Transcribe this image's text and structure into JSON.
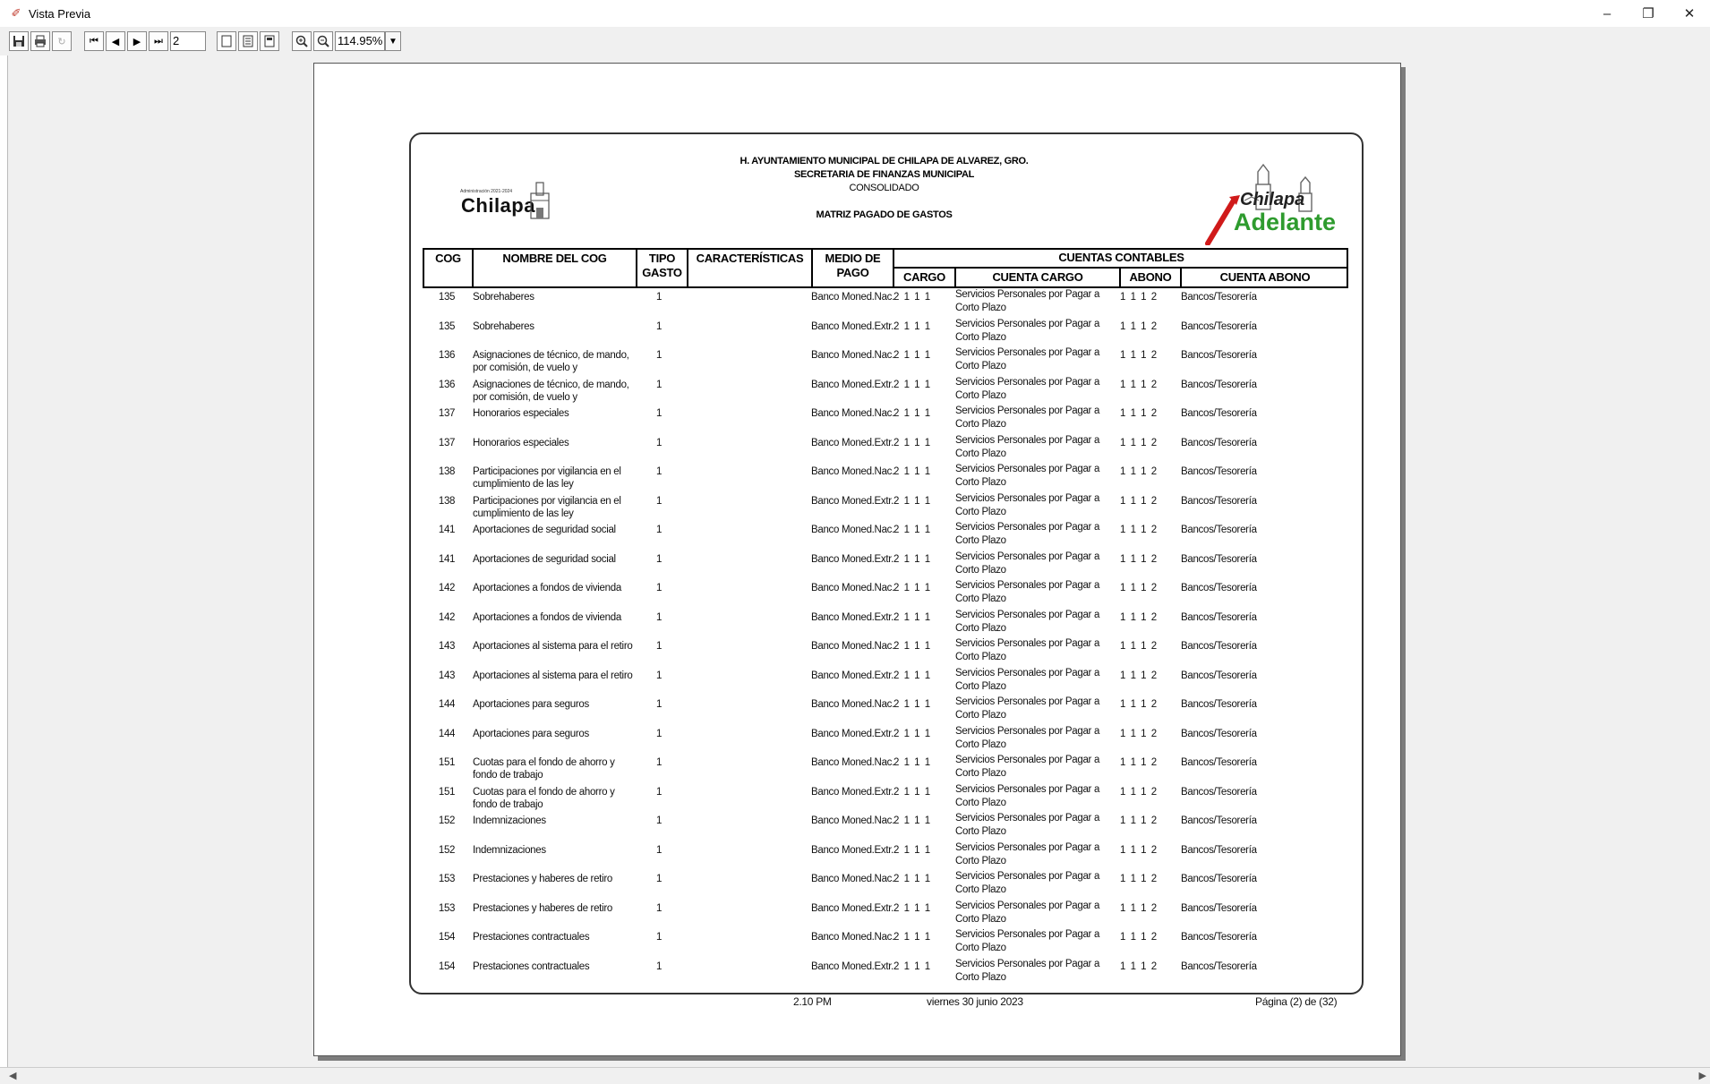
{
  "window": {
    "title": "Vista Previa",
    "minimize": "–",
    "restore": "❐",
    "close": "✕"
  },
  "toolbar": {
    "page_value": "2",
    "zoom_value": "114.95%"
  },
  "report": {
    "line1": "H. AYUNTAMIENTO MUNICIPAL DE CHILAPA DE ALVAREZ, GRO.",
    "line2": "SECRETARIA DE FINANZAS MUNICIPAL",
    "line3": "CONSOLIDADO",
    "line4": "MATRIZ PAGADO DE GASTOS",
    "logo_left_small": "Administración 2021-2024",
    "logo_left_word": "Chilapa",
    "logo_right_top": "Chilapa",
    "logo_right_bottom": "Adelante"
  },
  "table": {
    "headers": {
      "cog": "COG",
      "nombre": "NOMBRE DEL COG",
      "tipo": "TIPO GASTO",
      "caracteristicas": "CARACTERÍSTICAS",
      "medio": "MEDIO DE PAGO",
      "cuentas": "CUENTAS CONTABLES",
      "cargo": "CARGO",
      "cuenta_cargo": "CUENTA CARGO",
      "abono": "ABONO",
      "cuenta_abono": "CUENTA ABONO"
    },
    "rows": [
      {
        "cog": "135",
        "nombre": "Sobrehaberes",
        "tipo": "1",
        "medio": "Banco Moned.Nac.",
        "cargo": "2 1 1 1",
        "cuenta_cargo": "Servicios Personales por Pagar a Corto Plazo",
        "abono": "1 1 1 2",
        "cuenta_abono": "Bancos/Tesorería"
      },
      {
        "cog": "135",
        "nombre": "Sobrehaberes",
        "tipo": "1",
        "medio": "Banco Moned.Extr.",
        "cargo": "2 1 1 1",
        "cuenta_cargo": "Servicios Personales por Pagar a Corto Plazo",
        "abono": "1 1 1 2",
        "cuenta_abono": "Bancos/Tesorería"
      },
      {
        "cog": "136",
        "nombre": "Asignaciones de técnico, de mando, por comisión, de vuelo y",
        "tipo": "1",
        "medio": "Banco Moned.Nac.",
        "cargo": "2 1 1 1",
        "cuenta_cargo": "Servicios Personales por Pagar a Corto Plazo",
        "abono": "1 1 1 2",
        "cuenta_abono": "Bancos/Tesorería"
      },
      {
        "cog": "136",
        "nombre": "Asignaciones de técnico, de mando, por comisión, de vuelo y",
        "tipo": "1",
        "medio": "Banco Moned.Extr.",
        "cargo": "2 1 1 1",
        "cuenta_cargo": "Servicios Personales por Pagar a Corto Plazo",
        "abono": "1 1 1 2",
        "cuenta_abono": "Bancos/Tesorería"
      },
      {
        "cog": "137",
        "nombre": "Honorarios especiales",
        "tipo": "1",
        "medio": "Banco Moned.Nac.",
        "cargo": "2 1 1 1",
        "cuenta_cargo": "Servicios Personales por Pagar a Corto Plazo",
        "abono": "1 1 1 2",
        "cuenta_abono": "Bancos/Tesorería"
      },
      {
        "cog": "137",
        "nombre": "Honorarios especiales",
        "tipo": "1",
        "medio": "Banco Moned.Extr.",
        "cargo": "2 1 1 1",
        "cuenta_cargo": "Servicios Personales por Pagar a Corto Plazo",
        "abono": "1 1 1 2",
        "cuenta_abono": "Bancos/Tesorería"
      },
      {
        "cog": "138",
        "nombre": "Participaciones por vigilancia en el cumplimiento de las ley",
        "tipo": "1",
        "medio": "Banco Moned.Nac.",
        "cargo": "2 1 1 1",
        "cuenta_cargo": "Servicios Personales por Pagar a Corto Plazo",
        "abono": "1 1 1 2",
        "cuenta_abono": "Bancos/Tesorería"
      },
      {
        "cog": "138",
        "nombre": "Participaciones por vigilancia en el cumplimiento de las ley",
        "tipo": "1",
        "medio": "Banco Moned.Extr.",
        "cargo": "2 1 1 1",
        "cuenta_cargo": "Servicios Personales por Pagar a Corto Plazo",
        "abono": "1 1 1 2",
        "cuenta_abono": "Bancos/Tesorería"
      },
      {
        "cog": "141",
        "nombre": "Aportaciones de seguridad social",
        "tipo": "1",
        "medio": "Banco Moned.Nac.",
        "cargo": "2 1 1 1",
        "cuenta_cargo": "Servicios Personales por Pagar a Corto Plazo",
        "abono": "1 1 1 2",
        "cuenta_abono": "Bancos/Tesorería"
      },
      {
        "cog": "141",
        "nombre": "Aportaciones de seguridad social",
        "tipo": "1",
        "medio": "Banco Moned.Extr.",
        "cargo": "2 1 1 1",
        "cuenta_cargo": "Servicios Personales por Pagar a Corto Plazo",
        "abono": "1 1 1 2",
        "cuenta_abono": "Bancos/Tesorería"
      },
      {
        "cog": "142",
        "nombre": "Aportaciones a fondos de vivienda",
        "tipo": "1",
        "medio": "Banco Moned.Nac.",
        "cargo": "2 1 1 1",
        "cuenta_cargo": "Servicios Personales por Pagar a Corto Plazo",
        "abono": "1 1 1 2",
        "cuenta_abono": "Bancos/Tesorería"
      },
      {
        "cog": "142",
        "nombre": "Aportaciones a fondos de vivienda",
        "tipo": "1",
        "medio": "Banco Moned.Extr.",
        "cargo": "2 1 1 1",
        "cuenta_cargo": "Servicios Personales por Pagar a Corto Plazo",
        "abono": "1 1 1 2",
        "cuenta_abono": "Bancos/Tesorería"
      },
      {
        "cog": "143",
        "nombre": "Aportaciones al sistema para el retiro",
        "tipo": "1",
        "medio": "Banco Moned.Nac.",
        "cargo": "2 1 1 1",
        "cuenta_cargo": "Servicios Personales por Pagar a Corto Plazo",
        "abono": "1 1 1 2",
        "cuenta_abono": "Bancos/Tesorería"
      },
      {
        "cog": "143",
        "nombre": "Aportaciones al sistema para el retiro",
        "tipo": "1",
        "medio": "Banco Moned.Extr.",
        "cargo": "2 1 1 1",
        "cuenta_cargo": "Servicios Personales por Pagar a Corto Plazo",
        "abono": "1 1 1 2",
        "cuenta_abono": "Bancos/Tesorería"
      },
      {
        "cog": "144",
        "nombre": "Aportaciones para seguros",
        "tipo": "1",
        "medio": "Banco Moned.Nac.",
        "cargo": "2 1 1 1",
        "cuenta_cargo": "Servicios Personales por Pagar a Corto Plazo",
        "abono": "1 1 1 2",
        "cuenta_abono": "Bancos/Tesorería"
      },
      {
        "cog": "144",
        "nombre": "Aportaciones para seguros",
        "tipo": "1",
        "medio": "Banco Moned.Extr.",
        "cargo": "2 1 1 1",
        "cuenta_cargo": "Servicios Personales por Pagar a Corto Plazo",
        "abono": "1 1 1 2",
        "cuenta_abono": "Bancos/Tesorería"
      },
      {
        "cog": "151",
        "nombre": "Cuotas para el fondo de ahorro y fondo de trabajo",
        "tipo": "1",
        "medio": "Banco Moned.Nac.",
        "cargo": "2 1 1 1",
        "cuenta_cargo": "Servicios Personales por Pagar a Corto Plazo",
        "abono": "1 1 1 2",
        "cuenta_abono": "Bancos/Tesorería"
      },
      {
        "cog": "151",
        "nombre": "Cuotas para el fondo de ahorro y fondo de trabajo",
        "tipo": "1",
        "medio": "Banco Moned.Extr.",
        "cargo": "2 1 1 1",
        "cuenta_cargo": "Servicios Personales por Pagar a Corto Plazo",
        "abono": "1 1 1 2",
        "cuenta_abono": "Bancos/Tesorería"
      },
      {
        "cog": "152",
        "nombre": "Indemnizaciones",
        "tipo": "1",
        "medio": "Banco Moned.Nac.",
        "cargo": "2 1 1 1",
        "cuenta_cargo": "Servicios Personales por Pagar a Corto Plazo",
        "abono": "1 1 1 2",
        "cuenta_abono": "Bancos/Tesorería"
      },
      {
        "cog": "152",
        "nombre": "Indemnizaciones",
        "tipo": "1",
        "medio": "Banco Moned.Extr.",
        "cargo": "2 1 1 1",
        "cuenta_cargo": "Servicios Personales por Pagar a Corto Plazo",
        "abono": "1 1 1 2",
        "cuenta_abono": "Bancos/Tesorería"
      },
      {
        "cog": "153",
        "nombre": "Prestaciones y haberes de retiro",
        "tipo": "1",
        "medio": "Banco Moned.Nac.",
        "cargo": "2 1 1 1",
        "cuenta_cargo": "Servicios Personales por Pagar a Corto Plazo",
        "abono": "1 1 1 2",
        "cuenta_abono": "Bancos/Tesorería"
      },
      {
        "cog": "153",
        "nombre": "Prestaciones y haberes de retiro",
        "tipo": "1",
        "medio": "Banco Moned.Extr.",
        "cargo": "2 1 1 1",
        "cuenta_cargo": "Servicios Personales por Pagar a Corto Plazo",
        "abono": "1 1 1 2",
        "cuenta_abono": "Bancos/Tesorería"
      },
      {
        "cog": "154",
        "nombre": "Prestaciones contractuales",
        "tipo": "1",
        "medio": "Banco Moned.Nac.",
        "cargo": "2 1 1 1",
        "cuenta_cargo": "Servicios Personales por Pagar a Corto Plazo",
        "abono": "1 1 1 2",
        "cuenta_abono": "Bancos/Tesorería"
      },
      {
        "cog": "154",
        "nombre": "Prestaciones contractuales",
        "tipo": "1",
        "medio": "Banco Moned.Extr.",
        "cargo": "2 1 1 1",
        "cuenta_cargo": "Servicios Personales por Pagar a Corto Plazo",
        "abono": "1 1 1 2",
        "cuenta_abono": "Bancos/Tesorería"
      }
    ]
  },
  "footer": {
    "time": "2.10 PM",
    "date": "viernes 30 junio 2023",
    "page": "Página (2) de (32)"
  }
}
